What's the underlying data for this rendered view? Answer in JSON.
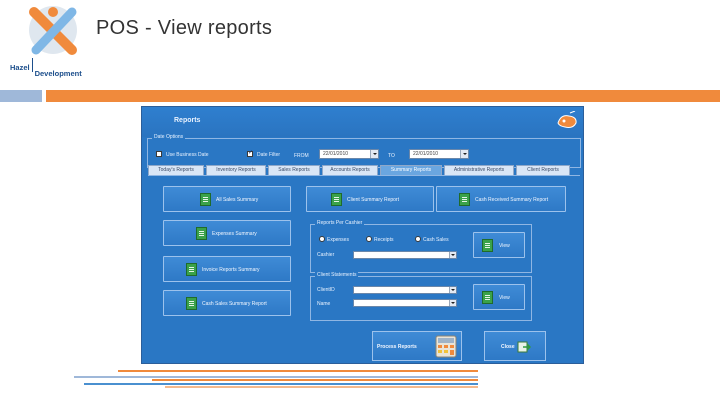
{
  "slide": {
    "title": "POS - View reports",
    "logo_text_1": "Hazel",
    "logo_text_2": "Development"
  },
  "colors": {
    "accent_orange": "#f08a3c",
    "accent_blue": "#9fb8d9",
    "app_blue": "#2a77c4"
  },
  "app": {
    "title": "Reports",
    "header_icon": "palette-icon",
    "date_options": {
      "group_label": "Date Options",
      "use_business_date_label": "Use Business Date",
      "use_business_date_checked": false,
      "date_filter_label": "Date Filter",
      "date_filter_checked": true,
      "from_label": "FROM",
      "from_value": "22/01/2010",
      "to_label": "TO",
      "to_value": "22/01/2010"
    },
    "tabs": [
      {
        "label": "Today's Reports",
        "active": false
      },
      {
        "label": "Inventory Reports",
        "active": false
      },
      {
        "label": "Sales Reports",
        "active": false
      },
      {
        "label": "Accounts Reports",
        "active": false
      },
      {
        "label": "Summary Reports",
        "active": true
      },
      {
        "label": "Administrative Reports",
        "active": false
      },
      {
        "label": "Client Reports",
        "active": false
      }
    ],
    "buttons": {
      "all_sales_summary": "All Sales Summary",
      "client_summary_report": "Client Summary Report",
      "cash received_summary_report": "Cash Received Summary Report",
      "expenses_summary": "Expenses Summary",
      "invoice_reports_summary": "Invoice Reports Summary",
      "cash_sales_summary_report": "Cash Sales Summary Report",
      "process_reports": "Process Reports",
      "close": "Close"
    },
    "cashier": {
      "group_label": "Reports Per Cashier",
      "expenses_label": "Expenses",
      "receipts_label": "Receipts",
      "cash_sales_label": "Cash Sales",
      "cashier_label": "Cashier",
      "cashier_value": "",
      "view_label": "View"
    },
    "client": {
      "group_label": "Client Statements",
      "client_id_label": "ClientID",
      "client_id_value": "",
      "name_label": "Name",
      "name_value": "",
      "view_label": "View"
    }
  }
}
